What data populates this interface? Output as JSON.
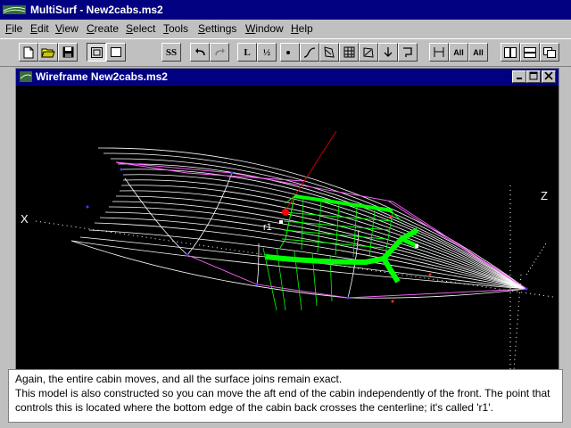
{
  "window": {
    "title": "MultiSurf - New2cabs.ms2"
  },
  "menu": [
    "File",
    "Edit",
    "View",
    "Create",
    "Select",
    "Tools",
    "Settings",
    "Window",
    "Help"
  ],
  "toolbar": {
    "ss": "SS",
    "lf": "L",
    "half": "½",
    "all_s": "All",
    "all_s2": "All"
  },
  "mdi": {
    "title": "Wireframe New2cabs.ms2"
  },
  "viewport": {
    "axis_x": "X",
    "axis_z": "Z",
    "point_label": "r1",
    "colors": {
      "hull": "#ffffff",
      "cabin": "#00ff00",
      "control_line": "#ff00ff",
      "point": "#ff0000"
    }
  },
  "caption": {
    "line1": "Again, the entire cabin moves, and all the surface joins remain exact.",
    "line2": "This model is also constructed so you can move the aft end of the cabin independently of the front. The point that controls this is located where the bottom edge of the cabin back crosses the centerline; it's called 'r1'."
  }
}
